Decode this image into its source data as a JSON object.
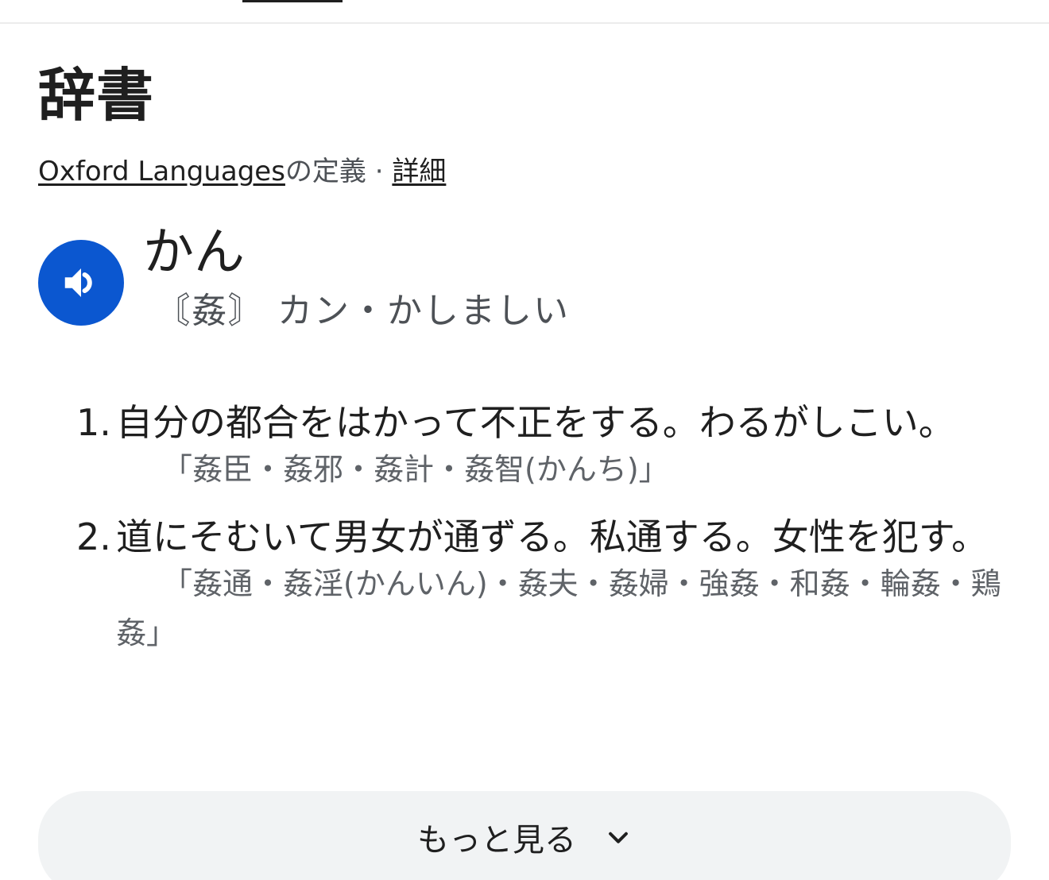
{
  "dictionary": {
    "title": "辞書",
    "source": {
      "provider": "Oxford Languages",
      "suffix": "の定義",
      "separator": " · ",
      "details_link": "詳細"
    },
    "entry": {
      "headword": "かん",
      "reading": "〘姦〙 カン・かしましい",
      "pronounce_icon": "speaker-icon",
      "senses": [
        {
          "number": "1.",
          "definition": "自分の都合をはかって不正をする。わるがしこい。",
          "examples": "「姦臣・姦邪・姦計・姦智(かんち)」"
        },
        {
          "number": "2.",
          "definition": "道にそむいて男女が通ずる。私通する。女性を犯す。",
          "examples": "「姦通・姦淫(かんいん)・姦夫・姦婦・強姦・和姦・輪姦・鶏姦」"
        }
      ]
    },
    "more_button": {
      "label": "もっと見る",
      "icon": "chevron-down-icon"
    }
  },
  "colors": {
    "accent": "#0b57d0",
    "text_primary": "#1f1f1f",
    "text_secondary": "#5f6368",
    "button_bg": "#f1f3f4"
  }
}
